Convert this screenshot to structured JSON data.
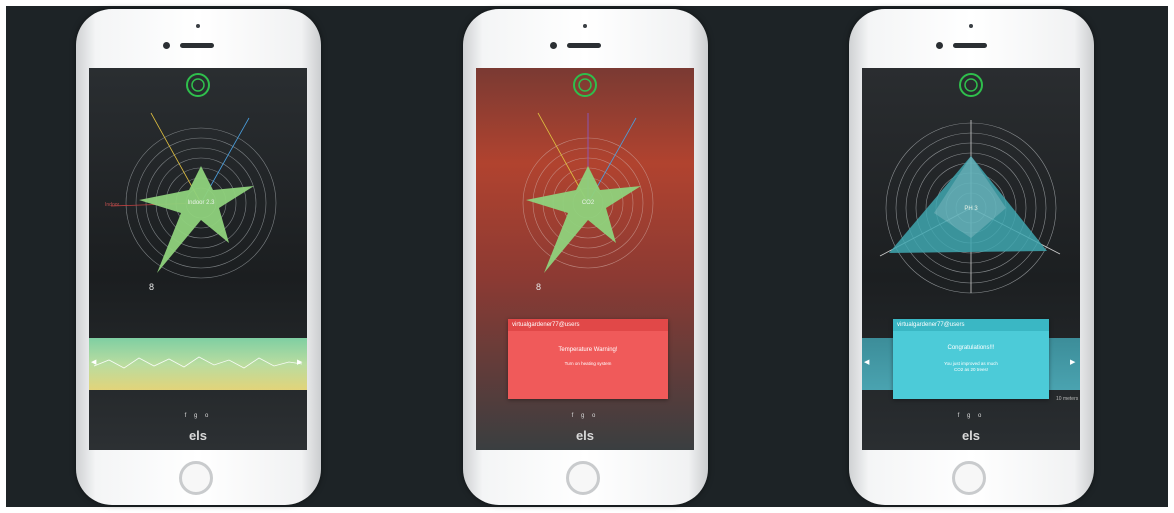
{
  "phones": [
    {
      "id": "phone-1",
      "center_label": "Indoor 2.3",
      "axis_labels": {
        "left": "Indoor"
      },
      "social_icons": [
        "f",
        "g",
        "o"
      ],
      "brand": "els",
      "chart_markers": {
        "bottom": "8"
      }
    },
    {
      "id": "phone-2",
      "center_label": "CO2",
      "popup": {
        "header": "virtualgardener77@users",
        "title": "Temperature Warning!",
        "message": "Turn on heating system"
      },
      "social_icons": [
        "f",
        "g",
        "o"
      ],
      "brand": "els",
      "chart_markers": {
        "bottom": "8"
      }
    },
    {
      "id": "phone-3",
      "center_label": "PH 3",
      "popup": {
        "header": "virtualgardener77@users",
        "title": "Congratulations!!!",
        "message_line1": "You just improved as much",
        "message_line2": "CO2 as 20 trees!"
      },
      "social_icons": [
        "f",
        "g",
        "o"
      ],
      "brand": "els",
      "axis_labels": {
        "bottom_right": "10 meters"
      }
    }
  ],
  "colors": {
    "background": "#1d2326",
    "star_green": "#8fd27c",
    "triangle_teal": "#3fa7b0",
    "warning_red": "#f05a5a",
    "congrats_cyan": "#4ccbd8",
    "strip_top": "#8fd4a0",
    "strip_bottom": "#e8d46a",
    "logo_green": "#2fbf4c"
  }
}
